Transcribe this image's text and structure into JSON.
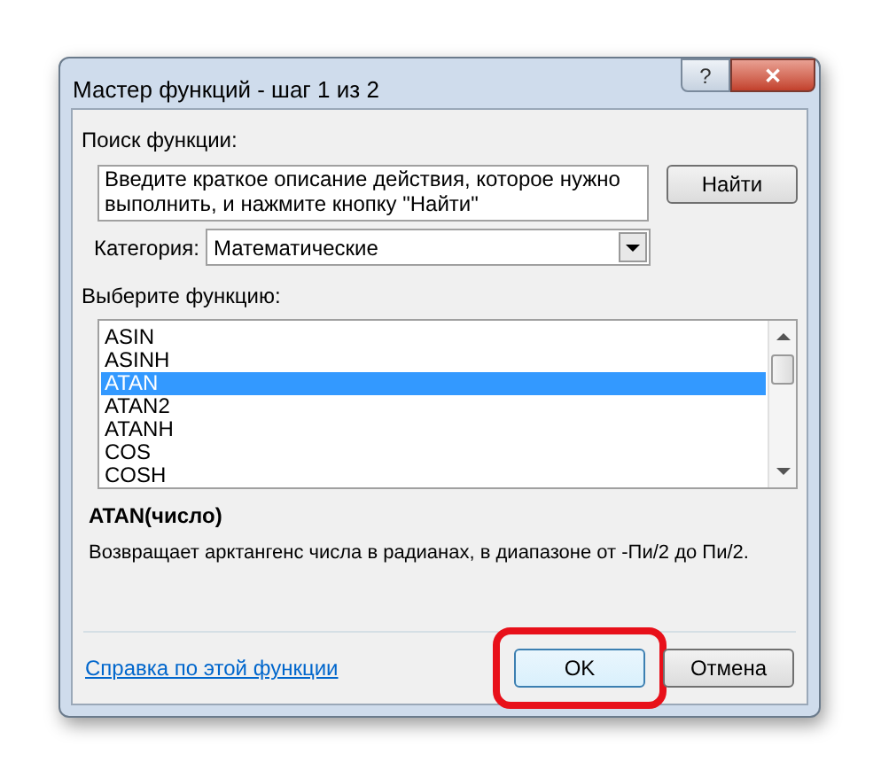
{
  "window": {
    "title": "Мастер функций - шаг 1 из 2",
    "help_button": "?",
    "close_button": "✕"
  },
  "search": {
    "label": "Поиск функции:",
    "value": "Введите краткое описание действия, которое нужно выполнить, и нажмите кнопку \"Найти\"",
    "button": "Найти"
  },
  "category": {
    "label": "Категория:",
    "value": "Математические"
  },
  "functions": {
    "label": "Выберите функцию:",
    "items": [
      {
        "name": "ASIN",
        "selected": false
      },
      {
        "name": "ASINH",
        "selected": false
      },
      {
        "name": "ATAN",
        "selected": true
      },
      {
        "name": "ATAN2",
        "selected": false
      },
      {
        "name": "ATANH",
        "selected": false
      },
      {
        "name": "COS",
        "selected": false
      },
      {
        "name": "COSH",
        "selected": false
      }
    ]
  },
  "signature": "ATAN(число)",
  "description": "Возвращает арктангенс числа в радианах, в диапазоне от -Пи/2 до Пи/2.",
  "help_link": "Справка по этой функции",
  "buttons": [
    {
      "label": "OK",
      "highlighted": true
    },
    {
      "label": "Отмена",
      "highlighted": false
    }
  ]
}
